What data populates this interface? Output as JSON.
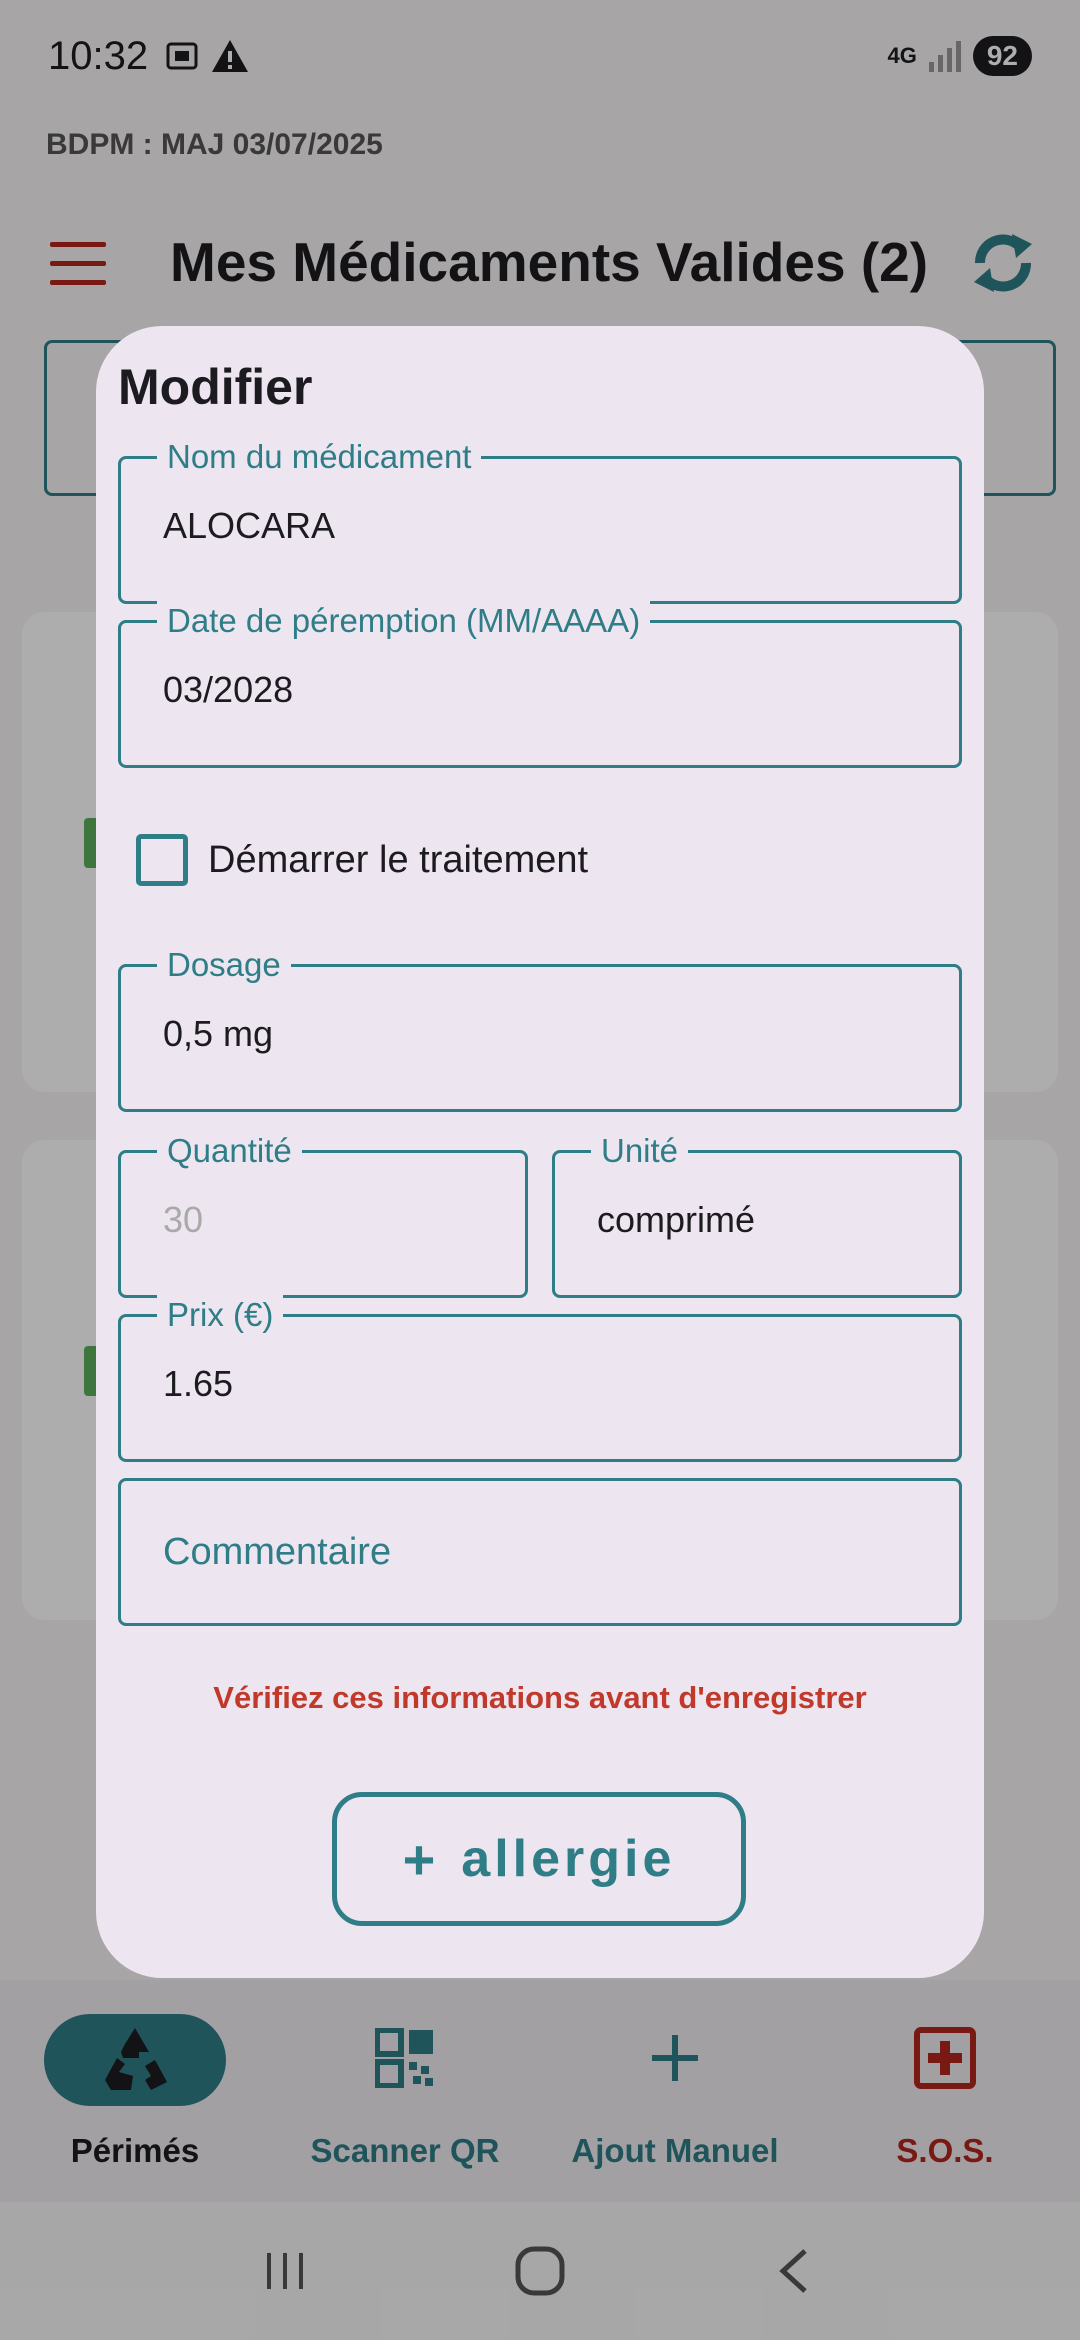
{
  "status_bar": {
    "time": "10:32",
    "network": "4G",
    "battery": "92"
  },
  "db_info": "BDPM : MAJ 03/07/2025",
  "header": {
    "title": "Mes Médicaments Valides (2)"
  },
  "bottom_nav": [
    {
      "label": "Périmés",
      "icon": "recycle-icon",
      "active": true
    },
    {
      "label": "Scanner QR",
      "icon": "qr-code-icon",
      "active": false
    },
    {
      "label": "Ajout Manuel",
      "icon": "plus-icon",
      "active": false
    },
    {
      "label": "S.O.S.",
      "icon": "first-aid-icon",
      "active": false
    }
  ],
  "dialog": {
    "title": "Modifier",
    "fields": {
      "name": {
        "label": "Nom du médicament",
        "value": "ALOCARA"
      },
      "expiry": {
        "label": "Date de péremption (MM/AAAA)",
        "value": "03/2028"
      },
      "dosage": {
        "label": "Dosage",
        "value": "0,5 mg"
      },
      "quantity": {
        "label": "Quantité",
        "placeholder": "30"
      },
      "unit": {
        "label": "Unité",
        "value": "comprimé"
      },
      "price": {
        "label": "Prix (€)",
        "value": "1.65"
      },
      "comment": {
        "placeholder": "Commentaire"
      }
    },
    "start_treatment": {
      "label": "Démarrer le traitement",
      "checked": false
    },
    "warning": "Vérifiez ces informations avant d'enregistrer",
    "allergy_button": {
      "plus": "+",
      "label": "allergie"
    }
  },
  "colors": {
    "accent": "#2f7d86",
    "danger": "#b3261e",
    "dialog_bg": "#ede6f0"
  }
}
